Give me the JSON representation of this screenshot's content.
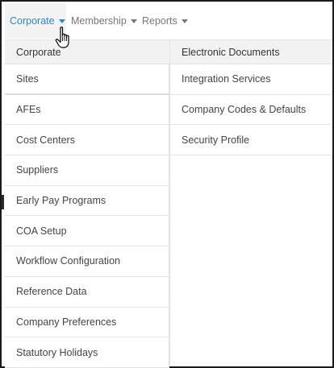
{
  "topnav": {
    "items": [
      {
        "label": "Corporate",
        "active": true
      },
      {
        "label": "Membership",
        "active": false
      },
      {
        "label": "Reports",
        "active": false
      }
    ]
  },
  "dropdown": {
    "left": {
      "header": "Corporate",
      "items": [
        "Sites",
        "AFEs",
        "Cost Centers",
        "Suppliers",
        "Early Pay Programs",
        "COA Setup",
        "Workflow Configuration",
        "Reference Data",
        "Company Preferences",
        "Statutory Holidays"
      ]
    },
    "right": {
      "header": "Electronic Documents",
      "items": [
        "Integration Services",
        "Company Codes & Defaults",
        "Security Profile"
      ]
    }
  },
  "colors": {
    "accent": "#2f86c9",
    "nav_text": "#777777",
    "header_bg": "#f2f2f2",
    "divider": "#e2e2e2"
  },
  "icons": {
    "caret": "caret-down-icon",
    "cursor": "hand-pointer-icon"
  }
}
